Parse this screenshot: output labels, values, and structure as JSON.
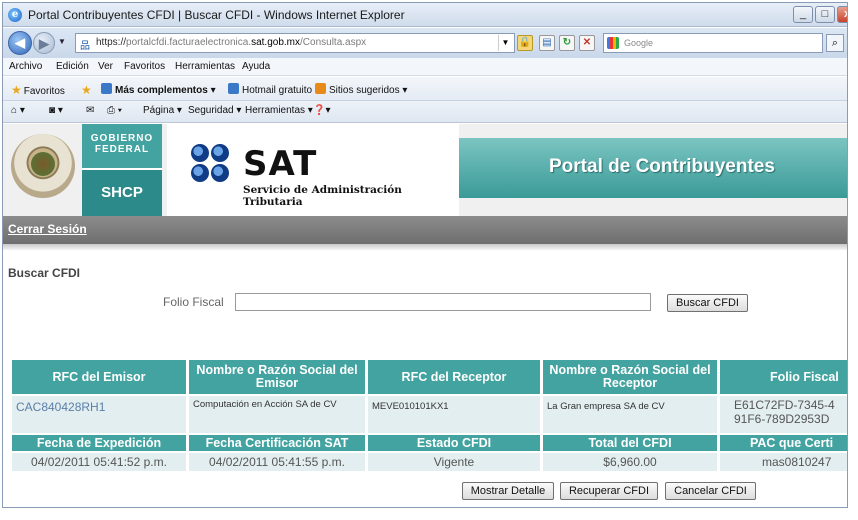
{
  "window": {
    "title": "Portal Contribuyentes CFDI | Buscar CFDI - Windows Internet Explorer",
    "min_glyph": "_",
    "max_glyph": "□",
    "close_glyph": "x"
  },
  "address_bar": {
    "url_prefix": "https://",
    "url_dim1": "portalcfdi.facturaelectronica.",
    "url_host": "sat.gob.mx",
    "url_path": "/Consulta.aspx",
    "search_placeholder": "Google"
  },
  "menu": [
    "Archivo",
    "Edición",
    "Ver",
    "Favoritos",
    "Herramientas",
    "Ayuda"
  ],
  "favorites_bar": {
    "favorites_label": "Favoritos",
    "more_addons": "Más complementos",
    "hotmail": "Hotmail gratuito",
    "suggested": "Sitios sugeridos"
  },
  "command_bar": {
    "page": "Página",
    "security": "Seguridad",
    "tools": "Herramientas"
  },
  "banner": {
    "gob_line1": "Gobierno",
    "gob_line2": "Federal",
    "shcp": "SHCP",
    "sat_name": "SAT",
    "sat_full": "Servicio de Administración Tributaria",
    "portal_title": "Portal de Contribuyentes"
  },
  "session": {
    "logout": "Cerrar Sesión"
  },
  "search_form": {
    "section_title": "Buscar CFDI",
    "folio_label": "Folio Fiscal",
    "folio_value": "",
    "search_button": "Buscar CFDI"
  },
  "results": {
    "header1": [
      "RFC del Emisor",
      "Nombre o Razón Social del Emisor",
      "RFC del Receptor",
      "Nombre o Razón Social del Receptor",
      "Folio Fiscal"
    ],
    "row1": [
      "CAC840428RH1",
      "Computación en Acción SA de CV",
      "MEVE010101KX1",
      "La Gran empresa SA de CV",
      "E61C72FD-7345-4 91F6-789D2953D"
    ],
    "header2": [
      "Fecha de Expedición",
      "Fecha Certificación SAT",
      "Estado CFDI",
      "Total del CFDI",
      "PAC que Certi"
    ],
    "row2": [
      "04/02/2011 05:41:52 p.m.",
      "04/02/2011 05:41:55 p.m.",
      "Vigente",
      "$6,960.00",
      "mas0810247"
    ]
  },
  "actions": {
    "detail": "Mostrar Detalle",
    "recover": "Recuperar CFDI",
    "cancel": "Cancelar CFDI"
  },
  "colors": {
    "teal_header": "#43a3a0",
    "teal_dark": "#2c8a8a",
    "data_row_bg": "#e3eef0",
    "session_bar": "#7a7a7a"
  }
}
